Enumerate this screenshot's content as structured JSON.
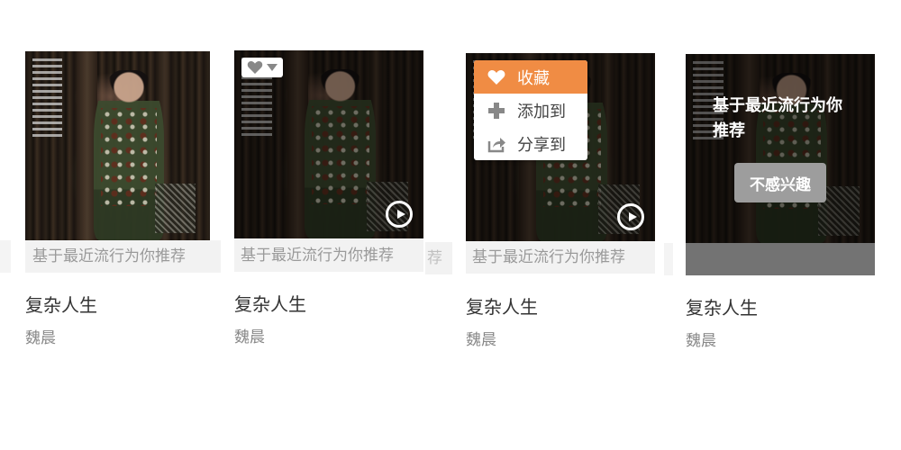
{
  "cards": [
    {
      "title": "复杂人生",
      "artist": "魏晨",
      "recommend_reason": "基于最近流行为你推荐"
    },
    {
      "title": "复杂人生",
      "artist": "魏晨",
      "recommend_reason": "基于最近流行为你推荐",
      "ribbon_overflow": "荐"
    },
    {
      "title": "复杂人生",
      "artist": "魏晨",
      "recommend_reason": "基于最近流行为你推荐",
      "menu": {
        "items": [
          {
            "label": "收藏",
            "icon": "heart-icon"
          },
          {
            "label": "添加到",
            "icon": "plus-icon"
          },
          {
            "label": "分享到",
            "icon": "share-icon"
          }
        ],
        "active_index": 0,
        "active_color": "#f08c44"
      }
    },
    {
      "title": "复杂人生",
      "artist": "魏晨",
      "overlay_text": "基于最近流行为你推荐",
      "not_interested_label": "不感兴趣"
    }
  ],
  "colors": {
    "accent": "#f08c44",
    "ribbon_bg": "#f2f2f2",
    "ribbon_text": "#9a9a9a"
  }
}
